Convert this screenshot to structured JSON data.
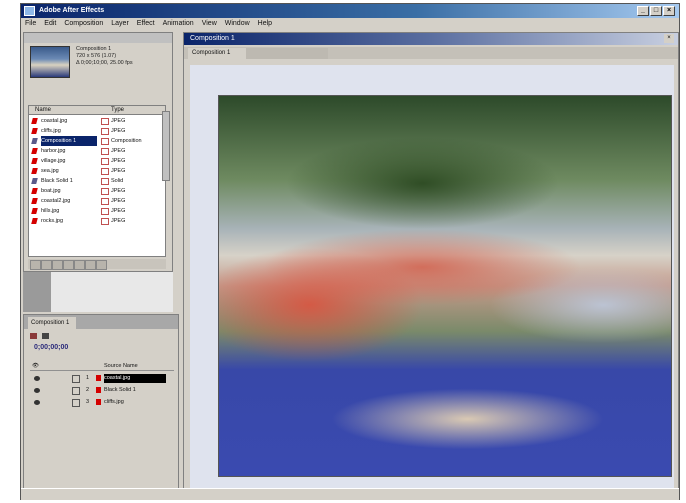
{
  "window": {
    "title": "Adobe After Effects",
    "menus": [
      "File",
      "Edit",
      "Composition",
      "Layer",
      "Effect",
      "Animation",
      "View",
      "Window",
      "Help"
    ]
  },
  "project": {
    "comp_name": "Composition 1",
    "comp_info": [
      "720 x 576 (1.07)",
      "Δ 0;00;10;00, 25.00 fps"
    ],
    "columns": {
      "name": "Name",
      "type": "Type"
    },
    "items": [
      {
        "name": "coastal.jpg",
        "type": "JPEG"
      },
      {
        "name": "cliffs.jpg",
        "type": "JPEG"
      },
      {
        "name": "Composition 1",
        "type": "Composition"
      },
      {
        "name": "harbor.jpg",
        "type": "JPEG"
      },
      {
        "name": "village.jpg",
        "type": "JPEG"
      },
      {
        "name": "sea.jpg",
        "type": "JPEG"
      },
      {
        "name": "Black Solid 1",
        "type": "Solid"
      },
      {
        "name": "boat.jpg",
        "type": "JPEG"
      },
      {
        "name": "coastal2.jpg",
        "type": "JPEG"
      },
      {
        "name": "hills.jpg",
        "type": "JPEG"
      },
      {
        "name": "rocks.jpg",
        "type": "JPEG"
      }
    ]
  },
  "timeline": {
    "tab": "Composition 1",
    "time": "0;00;00;00",
    "column_source": "Source Name",
    "layers": [
      {
        "num": "1",
        "name": "coastal.jpg"
      },
      {
        "num": "2",
        "name": "Black Solid 1"
      },
      {
        "num": "3",
        "name": "cliffs.jpg"
      }
    ]
  },
  "composition": {
    "title": "Composition 1",
    "tabs": [
      "Composition 1"
    ]
  }
}
